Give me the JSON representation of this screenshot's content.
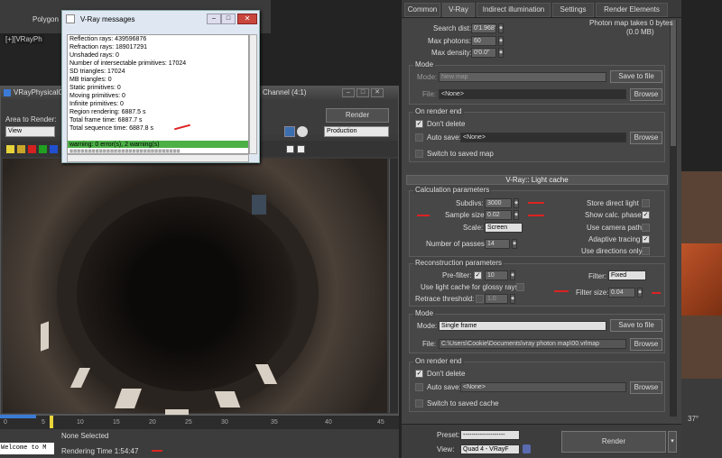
{
  "app": {
    "polygon_tab": "Polygon",
    "viewport_label": "[+][VRayPh"
  },
  "vfb": {
    "title": "VRayPhysicalC",
    "channel": "Channel (4:1)",
    "area_label": "Area to Render:",
    "area_value": "View",
    "production_value": "Production",
    "render_button": "Render",
    "win_min": "–",
    "win_max": "□",
    "win_close": "✕"
  },
  "timeline": {
    "ticks": [
      "0",
      "5",
      "10",
      "15",
      "20",
      "25",
      "30",
      "35",
      "40",
      "45"
    ]
  },
  "status": {
    "welcome": "Welcome to M",
    "none_selected": "None Selected",
    "render_time": "Rendering Time  1:54:47"
  },
  "messages": {
    "title": "V-Ray messages",
    "min": "–",
    "max": "□",
    "close": "✕",
    "lines": [
      "Reflection rays: 439596876",
      "Refraction rays: 189017291",
      "Unshaded rays: 0",
      "Number of intersectable primitives: 17024",
      "SD triangles: 17024",
      "MB triangles: 0",
      "Static primitives: 0",
      "Moving primitives: 0",
      "Infinite primitives: 0",
      "Region rendering: 6887.5 s",
      "Total frame time: 6887.7 s",
      "Total sequence time: 6887.8 s",
      "warning: 0 error(s), 2 warning(s)",
      "=============================="
    ]
  },
  "panel": {
    "tabs": [
      "Common",
      "V-Ray",
      "Indirect illumination",
      "Settings",
      "Render Elements"
    ],
    "photon_info": "Photon map takes 0 bytes",
    "photon_mb": "(0.0 MB)",
    "search_dist_label": "Search dist:",
    "search_dist_value": "0'1.968\"",
    "max_photons_label": "Max photons:",
    "max_photons_value": "60",
    "max_density_label": "Max density:",
    "max_density_value": "0'0.0\"",
    "mode1_title": "Mode",
    "mode1_label": "Mode:",
    "mode1_value": "New map",
    "save_to_file": "Save to file",
    "file_label": "File:",
    "file1_value": "<None>",
    "browse": "Browse",
    "render_end_title": "On render end",
    "dont_delete": "Don't delete",
    "auto_save": "Auto save:",
    "auto_save_value": "<None>",
    "switch_saved_map": "Switch to saved map",
    "lc_rollout": "V-Ray:: Light cache",
    "calc_title": "Calculation parameters",
    "subdivs_label": "Subdivs:",
    "subdivs_value": "3000",
    "sample_size_label": "Sample size:",
    "sample_size_value": "0.02",
    "scale_label": "Scale:",
    "scale_value": "Screen",
    "passes_label": "Number of passes:",
    "passes_value": "14",
    "store_direct": "Store direct light",
    "show_calc": "Show calc. phase",
    "use_camera": "Use camera path",
    "adaptive": "Adaptive tracing",
    "use_dirs": "Use directions only",
    "recon_title": "Reconstruction parameters",
    "prefilter_label": "Pre-filter:",
    "prefilter_value": "10",
    "use_lc_glossy": "Use light cache for glossy rays",
    "retrace_label": "Retrace threshold:",
    "retrace_value": "1.0",
    "filter_label": "Filter:",
    "filter_value": "Fixed",
    "filter_size_label": "Filter size:",
    "filter_size_value": "0.04",
    "mode2_title": "Mode",
    "mode2_label": "Mode:",
    "mode2_value": "Single frame",
    "file2_value": "C:\\Users\\Cookie\\Documents\\vray photon map\\00.vrlmap",
    "switch_saved_cache": "Switch to saved cache",
    "preset_label": "Preset:",
    "preset_value": "--------------------",
    "view_label": "View:",
    "view_value": "Quad 4 - VRayF",
    "render_button": "Render"
  },
  "viewport_corner": "37°"
}
